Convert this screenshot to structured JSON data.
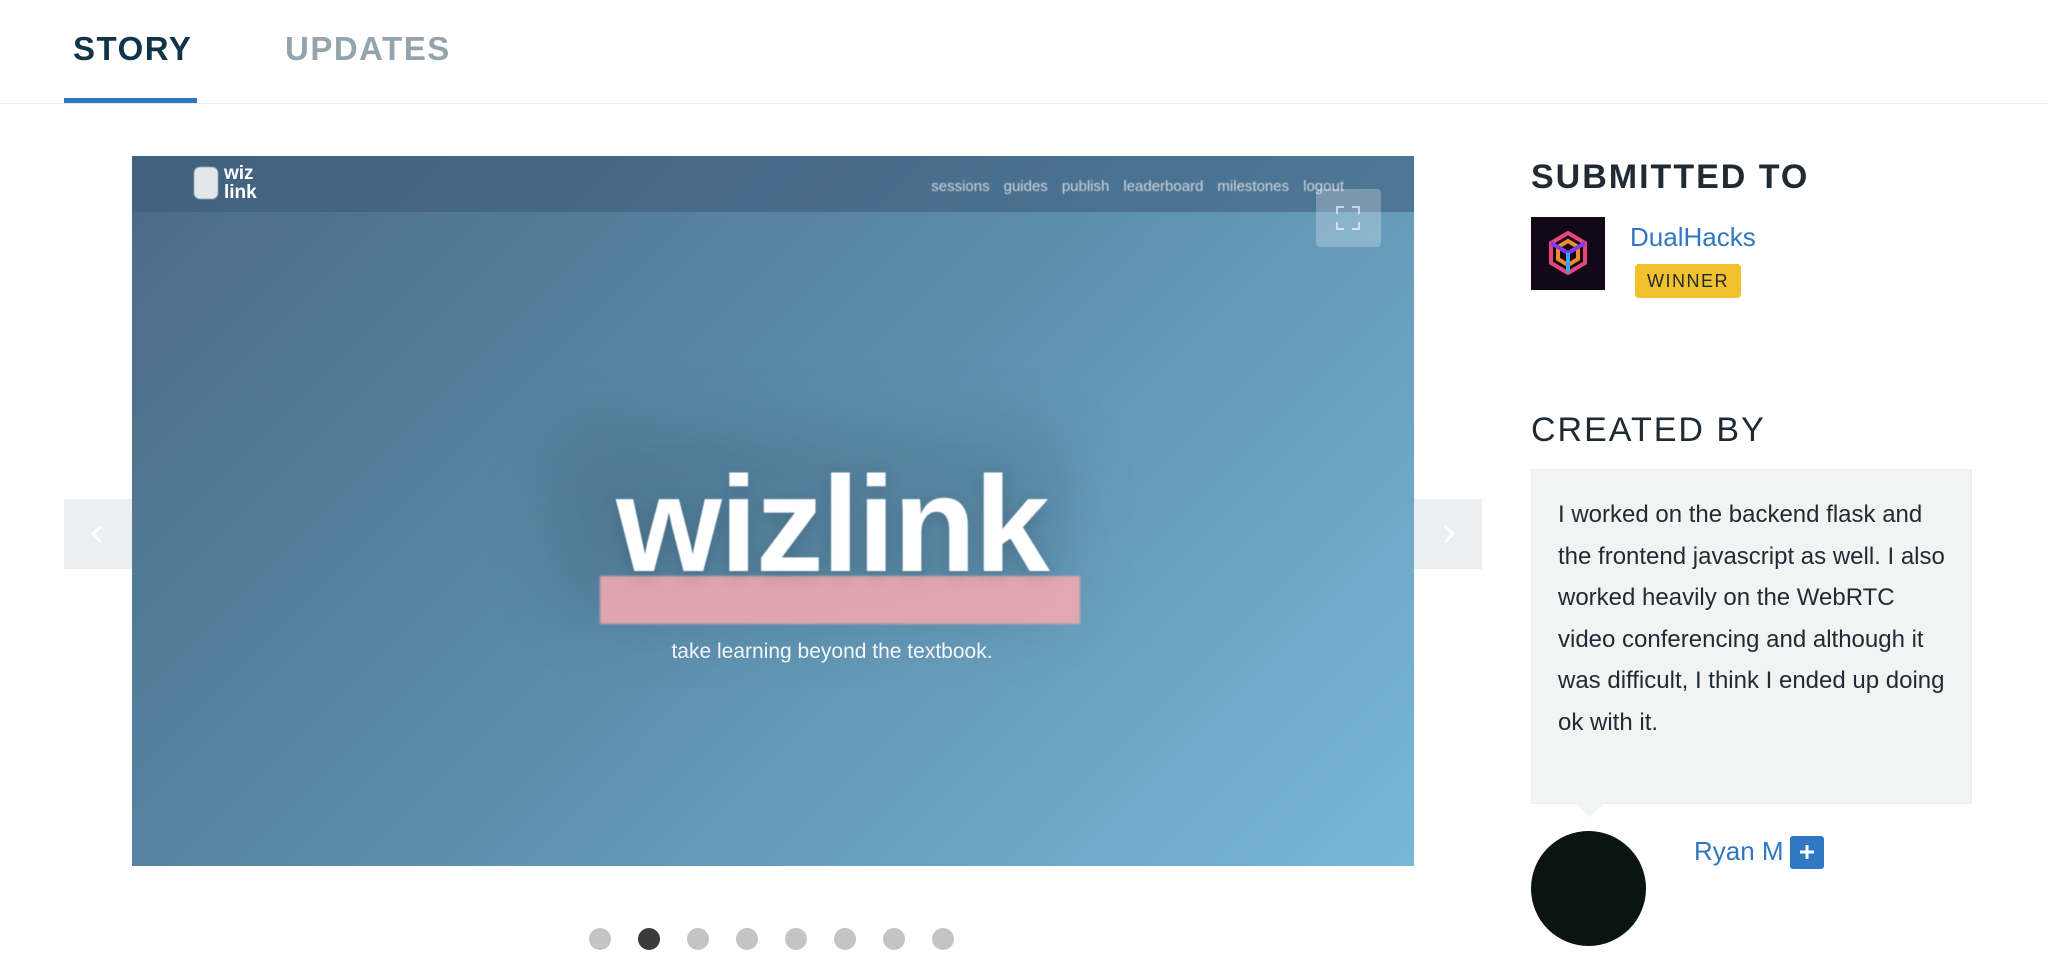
{
  "tabs": {
    "story": "STORY",
    "updates": "UPDATES"
  },
  "gallery": {
    "screenshot": {
      "logo_text": "wiz link",
      "nav_links": [
        "sessions",
        "guides",
        "publish",
        "leaderboard",
        "milestones",
        "logout"
      ],
      "hero_title": "wizlink",
      "hero_subtitle": "take learning beyond the textbook."
    },
    "slide_count": 8,
    "active_slide": 2
  },
  "sidebar": {
    "submitted_heading": "SUBMITTED TO",
    "hackathon_name": "DualHacks",
    "badge": "WINNER",
    "created_heading": "CREATED BY",
    "contribution": "I worked on the backend flask and the frontend javascript as well. I also worked heavily on the WebRTC video conferencing and although it was difficult, I think I ended up doing ok with it.",
    "author_name": "Ryan M"
  },
  "colors": {
    "accent": "#2f77c0",
    "badge": "#f2c12e",
    "tab_active": "#0f3547",
    "tab_inactive": "#93a4ae"
  },
  "icons": {
    "prev": "chevron-left-icon",
    "next": "chevron-right-icon",
    "expand": "expand-icon",
    "follow": "plus-icon"
  }
}
